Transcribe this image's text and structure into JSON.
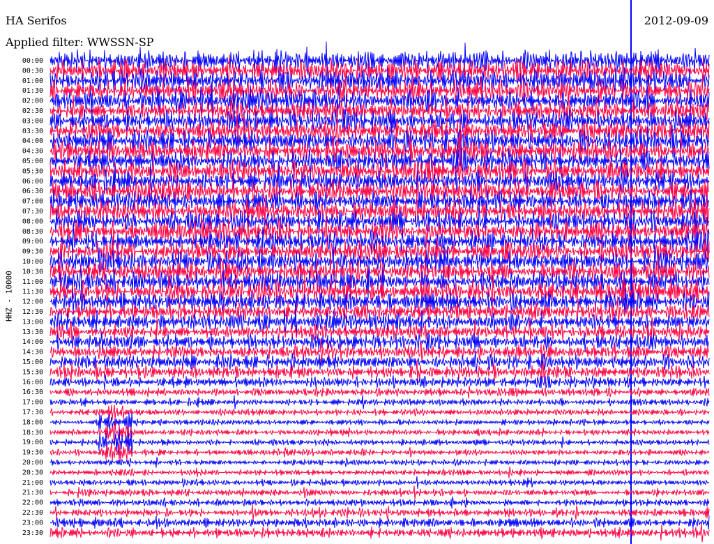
{
  "header": {
    "station": "HA Serifos",
    "date": "2012-09-09",
    "filter": "Applied filter: WWSSN-SP"
  },
  "chart_data": {
    "type": "line",
    "title": "HA Serifos",
    "ylabel": "HHZ - 10000",
    "row_labels": [
      "00:00",
      "00:30",
      "01:00",
      "01:30",
      "02:00",
      "02:30",
      "03:00",
      "03:30",
      "04:00",
      "04:30",
      "05:00",
      "05:30",
      "06:00",
      "06:30",
      "07:00",
      "07:30",
      "08:00",
      "08:30",
      "09:00",
      "09:30",
      "10:00",
      "10:30",
      "11:00",
      "11:30",
      "12:00",
      "12:30",
      "13:00",
      "13:30",
      "14:00",
      "14:30",
      "15:00",
      "15:30",
      "16:00",
      "16:30",
      "17:00",
      "17:30",
      "18:00",
      "18:30",
      "19:00",
      "19:30",
      "20:00",
      "20:30",
      "21:00",
      "21:30",
      "22:00",
      "22:30",
      "23:00",
      "23:30"
    ],
    "row_minutes": 30,
    "series_colors": [
      "#0000ff",
      "#ff0040"
    ],
    "noise_level": [
      1.0,
      1.0,
      1.0,
      1.0,
      1.0,
      1.0,
      1.0,
      1.0,
      1.0,
      1.0,
      1.0,
      1.0,
      1.0,
      1.0,
      1.0,
      1.0,
      1.0,
      1.0,
      1.0,
      1.0,
      1.0,
      1.0,
      1.0,
      1.0,
      0.9,
      0.85,
      0.8,
      0.75,
      0.75,
      0.7,
      0.7,
      0.6,
      0.55,
      0.4,
      0.35,
      0.3,
      0.3,
      0.3,
      0.3,
      0.3,
      0.3,
      0.3,
      0.3,
      0.35,
      0.35,
      0.4,
      0.45,
      0.5
    ],
    "events": [
      {
        "row": 37,
        "minute": 3,
        "label": "event"
      }
    ]
  }
}
